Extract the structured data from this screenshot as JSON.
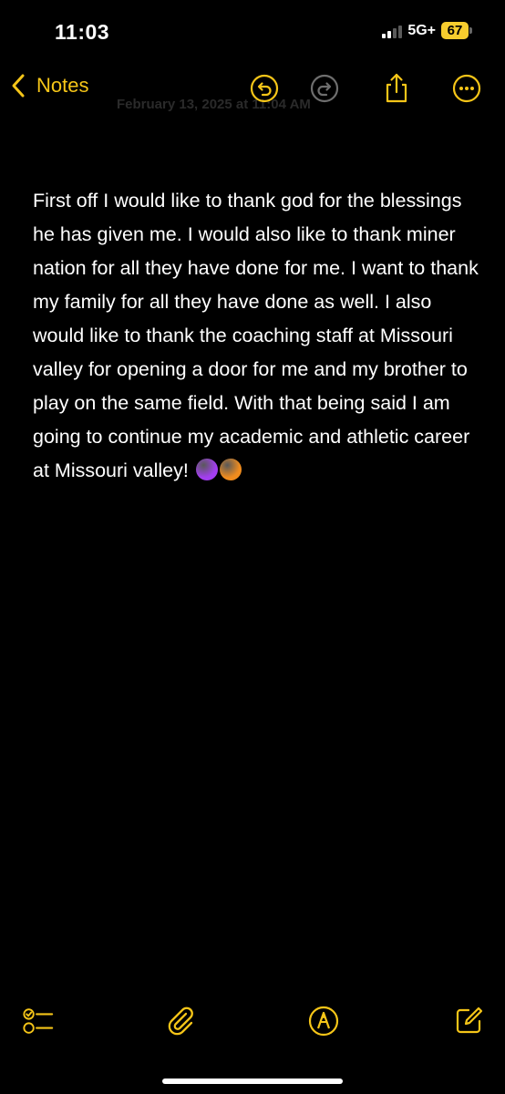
{
  "status_bar": {
    "time": "11:03",
    "network": "5G+",
    "battery": "67"
  },
  "nav": {
    "back_label": "Notes",
    "date_header": "February 13, 2025 at 11:04 AM",
    "accent": "#f5c518"
  },
  "note": {
    "text": "First off I would like to thank god for the blessings he has given me. I would also like to thank miner nation for all they have done for me. I want to thank my family for all they have done as well. I also would like to thank the coaching staff at Missouri valley for opening a door for me and my brother to play on the same field. With that being said I am going to continue my academic and athletic career at Missouri valley!",
    "emoji": [
      {
        "name": "purple-circle",
        "color": "#a33ef0"
      },
      {
        "name": "orange-circle",
        "color": "#f08c1e"
      }
    ]
  },
  "toolbar": {
    "icons": [
      "checklist-icon",
      "paperclip-icon",
      "markup-icon",
      "compose-icon"
    ]
  }
}
